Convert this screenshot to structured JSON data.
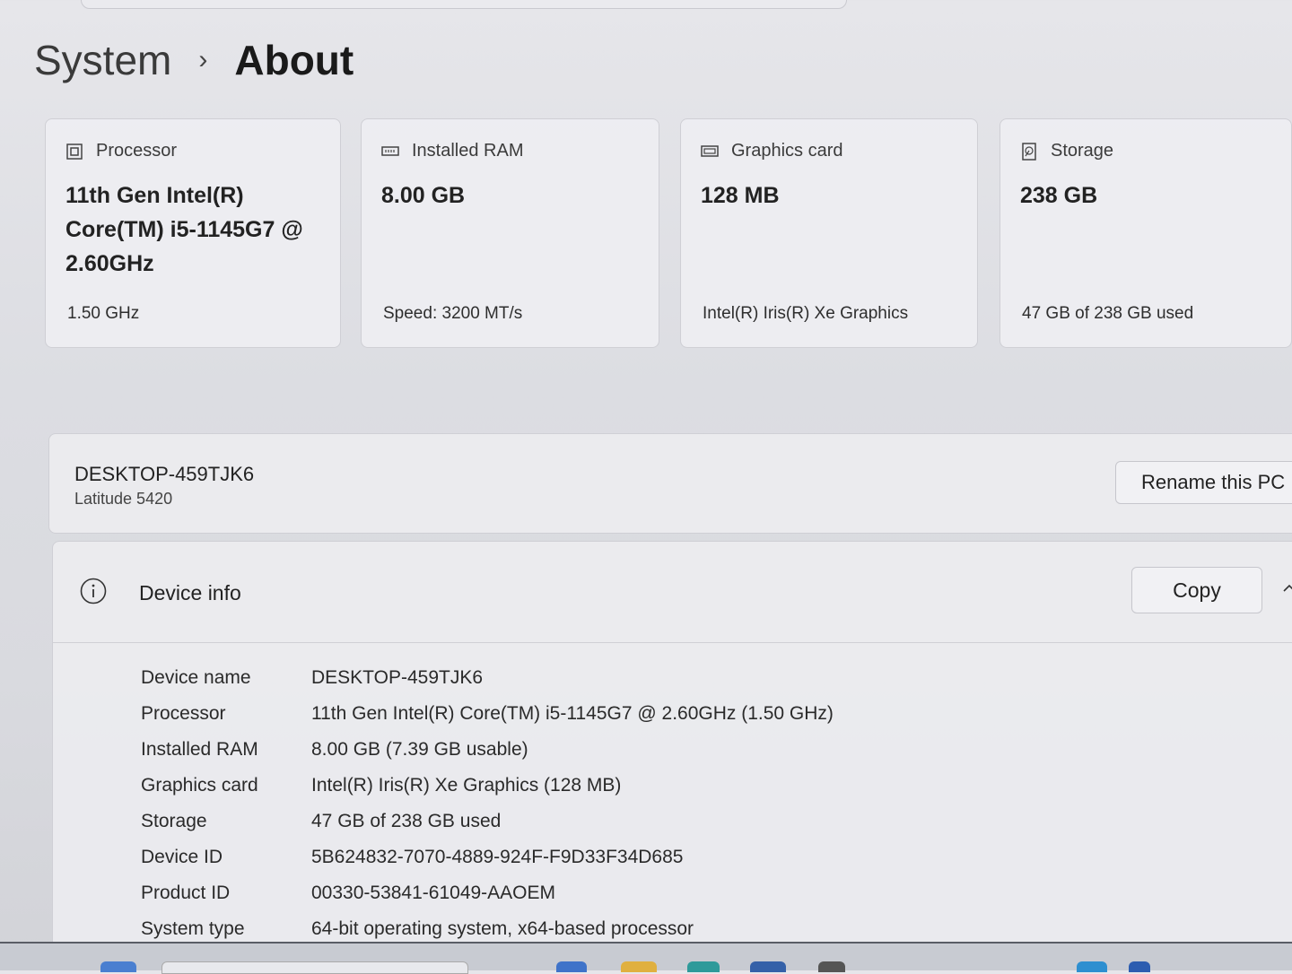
{
  "breadcrumb": {
    "root": "System",
    "separator": "›",
    "current": "About"
  },
  "cards": [
    {
      "icon": "processor-icon",
      "label": "Processor",
      "value": "11th Gen Intel(R) Core(TM) i5-1145G7 @ 2.60GHz",
      "sub": "1.50 GHz"
    },
    {
      "icon": "ram-icon",
      "label": "Installed RAM",
      "value": "8.00 GB",
      "sub": "Speed: 3200 MT/s"
    },
    {
      "icon": "graphics-card-icon",
      "label": "Graphics card",
      "value": "128 MB",
      "sub": "Intel(R) Iris(R) Xe Graphics"
    },
    {
      "icon": "storage-icon",
      "label": "Storage",
      "value": "238 GB",
      "sub": "47 GB of 238 GB used"
    }
  ],
  "pc": {
    "name": "DESKTOP-459TJK6",
    "model": "Latitude 5420",
    "rename_label": "Rename this PC"
  },
  "device_info": {
    "title": "Device info",
    "copy_label": "Copy",
    "rows": [
      {
        "label": "Device name",
        "value": "DESKTOP-459TJK6"
      },
      {
        "label": "Processor",
        "value": "11th Gen Intel(R) Core(TM) i5-1145G7 @ 2.60GHz (1.50 GHz)"
      },
      {
        "label": "Installed RAM",
        "value": "8.00 GB (7.39 GB usable)"
      },
      {
        "label": "Graphics card",
        "value": "Intel(R) Iris(R) Xe Graphics (128 MB)"
      },
      {
        "label": "Storage",
        "value": "47 GB of 238 GB used"
      },
      {
        "label": "Device ID",
        "value": "5B624832-7070-4889-924F-F9D33F34D685"
      },
      {
        "label": "Product ID",
        "value": "00330-53841-61049-AAOEM"
      },
      {
        "label": "System type",
        "value": "64-bit operating system, x64-based processor"
      }
    ]
  },
  "colors": {
    "page_background": "#dcdde2",
    "card_background": "#eeeef2",
    "border": "#cfcfd5",
    "text": "#222222"
  }
}
